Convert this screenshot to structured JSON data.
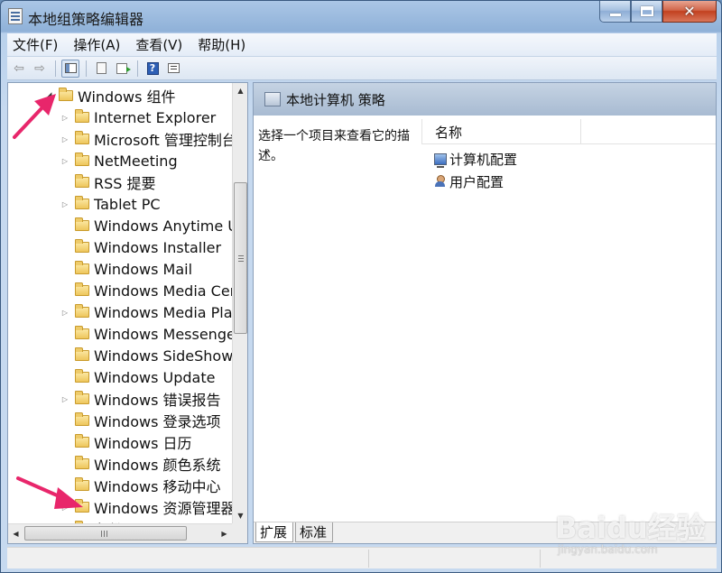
{
  "window": {
    "title": "本地组策略编辑器",
    "close_glyph": "✕"
  },
  "menu": [
    "文件(F)",
    "操作(A)",
    "查看(V)",
    "帮助(H)"
  ],
  "toolbar": {
    "back_glyph": "⇦",
    "forward_glyph": "⇨",
    "help_glyph": "?"
  },
  "tree": {
    "parent": {
      "label": "Windows 组件",
      "expanded": true
    },
    "items": [
      {
        "label": "Internet Explorer",
        "expandable": true
      },
      {
        "label": "Microsoft 管理控制台",
        "expandable": true
      },
      {
        "label": "NetMeeting",
        "expandable": true
      },
      {
        "label": "RSS 提要",
        "expandable": false
      },
      {
        "label": "Tablet PC",
        "expandable": true
      },
      {
        "label": "Windows Anytime Upgrade",
        "expandable": false
      },
      {
        "label": "Windows Installer",
        "expandable": false
      },
      {
        "label": "Windows Mail",
        "expandable": false
      },
      {
        "label": "Windows Media Center",
        "expandable": false
      },
      {
        "label": "Windows Media Player",
        "expandable": true
      },
      {
        "label": "Windows Messenger",
        "expandable": false
      },
      {
        "label": "Windows SideShow",
        "expandable": false
      },
      {
        "label": "Windows Update",
        "expandable": false
      },
      {
        "label": "Windows 错误报告",
        "expandable": true
      },
      {
        "label": "Windows 登录选项",
        "expandable": false
      },
      {
        "label": "Windows 日历",
        "expandable": false
      },
      {
        "label": "Windows 颜色系统",
        "expandable": false
      },
      {
        "label": "Windows 移动中心",
        "expandable": false
      },
      {
        "label": "Windows 资源管理器",
        "expandable": true
      },
      {
        "label": "备份",
        "expandable": true
      }
    ],
    "scroll_up_glyph": "▲",
    "scroll_down_glyph": "▼",
    "scroll_left_glyph": "◀",
    "scroll_right_glyph": "▶"
  },
  "right": {
    "header_title": "本地计算机 策略",
    "description": "选择一个项目来查看它的描述。",
    "column_name": "名称",
    "items": [
      {
        "label": "计算机配置",
        "icon": "computer-icon"
      },
      {
        "label": "用户配置",
        "icon": "user-icon"
      }
    ],
    "tabs": [
      "扩展",
      "标准"
    ]
  },
  "watermark": {
    "logo": "Baidu经验",
    "url": "jingyan.baidu.com"
  },
  "colors": {
    "annotation_arrow": "#e8266b",
    "title_bar": "#9dbbe0",
    "close_button": "#c2401f"
  }
}
